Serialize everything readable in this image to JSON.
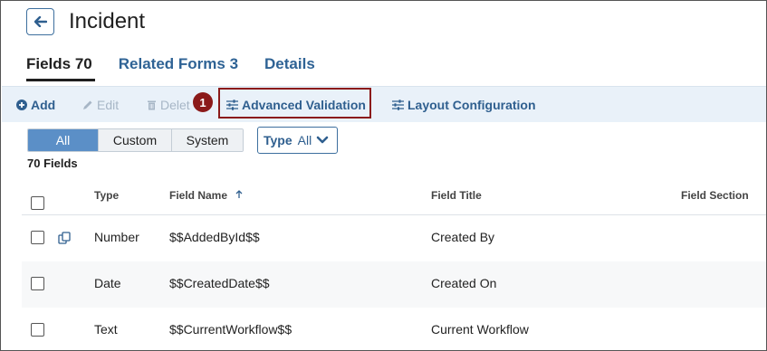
{
  "header": {
    "title": "Incident"
  },
  "tabs": [
    {
      "label": "Fields 70"
    },
    {
      "label": "Related Forms 3"
    },
    {
      "label": "Details"
    }
  ],
  "toolbar": {
    "add_label": "Add",
    "edit_label": "Edit",
    "delete_label": "Delet",
    "advanced_validation_label": "Advanced Validation",
    "layout_configuration_label": "Layout Configuration",
    "callout_number": "1",
    "highlight_color": "#8b1a1a"
  },
  "filters": {
    "segments": [
      "All",
      "Custom",
      "System"
    ],
    "type_label": "Type",
    "type_value": "All"
  },
  "field_count": "70 Fields",
  "table": {
    "columns": {
      "type": "Type",
      "field_name": "Field Name",
      "field_title": "Field Title",
      "field_section": "Field Section"
    },
    "rows": [
      {
        "type": "Number",
        "field_name": "$$AddedById$$",
        "field_title": "Created By",
        "field_section": ""
      },
      {
        "type": "Date",
        "field_name": "$$CreatedDate$$",
        "field_title": "Created On",
        "field_section": ""
      },
      {
        "type": "Text",
        "field_name": "$$CurrentWorkflow$$",
        "field_title": "Current Workflow",
        "field_section": ""
      }
    ]
  },
  "colors": {
    "accent": "#2f5f8f",
    "active_segment": "#5b8fc7",
    "toolbar_bg": "#e9f1f9"
  }
}
